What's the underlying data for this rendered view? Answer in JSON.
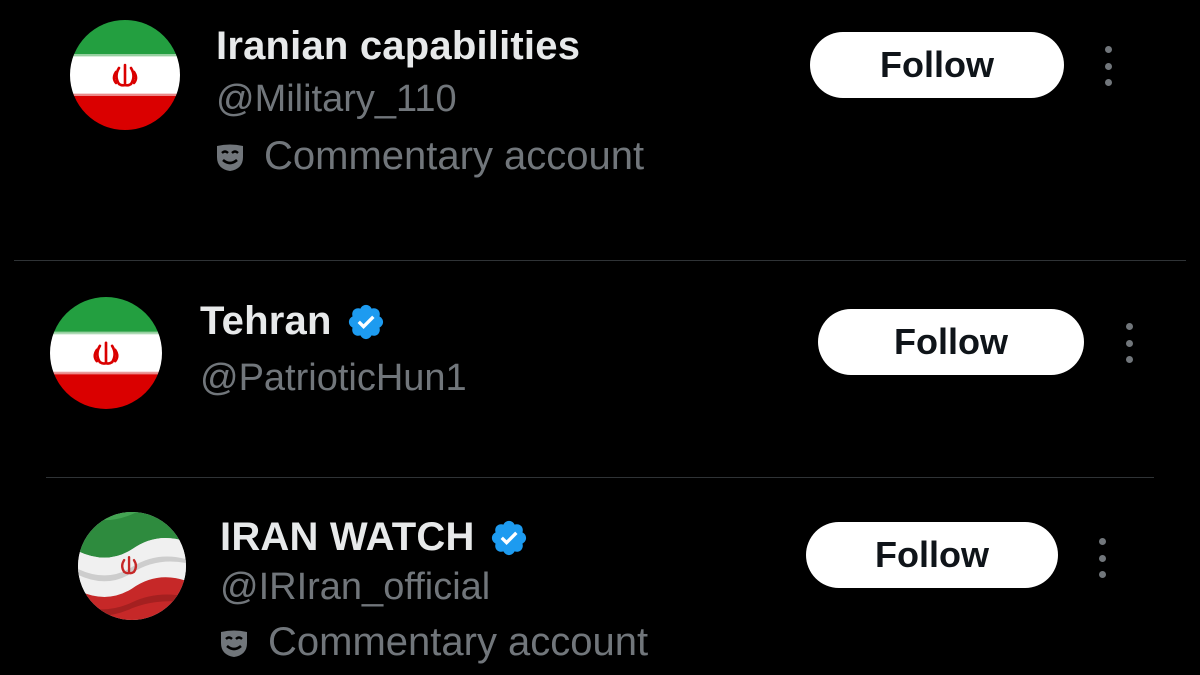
{
  "accounts": [
    {
      "display_name": "Iranian capabilities",
      "handle": "@Military_110",
      "verified": false,
      "label": "Commentary account",
      "follow_label": "Follow",
      "avatar_icon": "iran-flag-icon"
    },
    {
      "display_name": "Tehran",
      "handle": "@PatrioticHun1",
      "verified": true,
      "label": "",
      "follow_label": "Follow",
      "avatar_icon": "iran-flag-icon"
    },
    {
      "display_name": "IRAN WATCH",
      "handle": "@IRIran_official",
      "verified": true,
      "label": "Commentary account",
      "follow_label": "Follow",
      "avatar_icon": "waving-iran-flag-icon"
    }
  ],
  "colors": {
    "background": "#000000",
    "name": "#e7e9ea",
    "secondary": "#71767b",
    "verified": "#1d9bf0",
    "button_bg": "#ffffff",
    "button_text": "#0f1419",
    "divider": "#2f3336"
  }
}
